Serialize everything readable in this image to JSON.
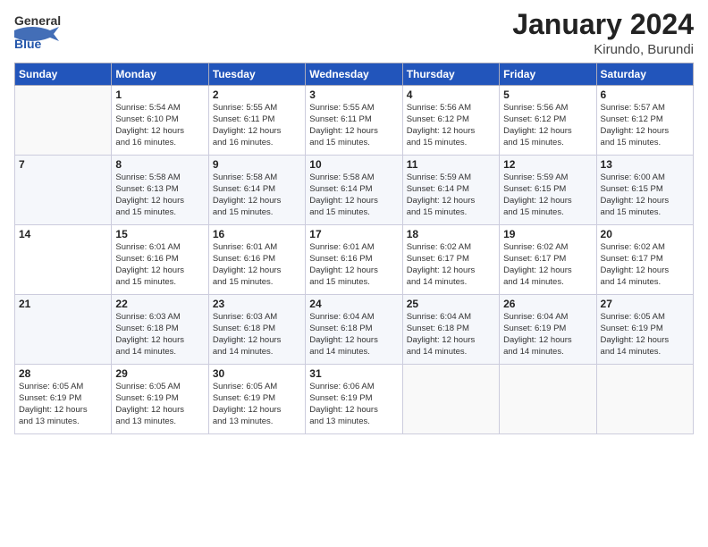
{
  "header": {
    "logo_line1": "General",
    "logo_line2": "Blue",
    "calendar_title": "January 2024",
    "calendar_subtitle": "Kirundo, Burundi"
  },
  "days_of_week": [
    "Sunday",
    "Monday",
    "Tuesday",
    "Wednesday",
    "Thursday",
    "Friday",
    "Saturday"
  ],
  "weeks": [
    [
      {
        "day": "",
        "info": ""
      },
      {
        "day": "1",
        "info": "Sunrise: 5:54 AM\nSunset: 6:10 PM\nDaylight: 12 hours\nand 16 minutes."
      },
      {
        "day": "2",
        "info": "Sunrise: 5:55 AM\nSunset: 6:11 PM\nDaylight: 12 hours\nand 16 minutes."
      },
      {
        "day": "3",
        "info": "Sunrise: 5:55 AM\nSunset: 6:11 PM\nDaylight: 12 hours\nand 15 minutes."
      },
      {
        "day": "4",
        "info": "Sunrise: 5:56 AM\nSunset: 6:12 PM\nDaylight: 12 hours\nand 15 minutes."
      },
      {
        "day": "5",
        "info": "Sunrise: 5:56 AM\nSunset: 6:12 PM\nDaylight: 12 hours\nand 15 minutes."
      },
      {
        "day": "6",
        "info": "Sunrise: 5:57 AM\nSunset: 6:12 PM\nDaylight: 12 hours\nand 15 minutes."
      }
    ],
    [
      {
        "day": "7",
        "info": ""
      },
      {
        "day": "8",
        "info": "Sunrise: 5:58 AM\nSunset: 6:13 PM\nDaylight: 12 hours\nand 15 minutes."
      },
      {
        "day": "9",
        "info": "Sunrise: 5:58 AM\nSunset: 6:14 PM\nDaylight: 12 hours\nand 15 minutes."
      },
      {
        "day": "10",
        "info": "Sunrise: 5:58 AM\nSunset: 6:14 PM\nDaylight: 12 hours\nand 15 minutes."
      },
      {
        "day": "11",
        "info": "Sunrise: 5:59 AM\nSunset: 6:14 PM\nDaylight: 12 hours\nand 15 minutes."
      },
      {
        "day": "12",
        "info": "Sunrise: 5:59 AM\nSunset: 6:15 PM\nDaylight: 12 hours\nand 15 minutes."
      },
      {
        "day": "13",
        "info": "Sunrise: 6:00 AM\nSunset: 6:15 PM\nDaylight: 12 hours\nand 15 minutes."
      }
    ],
    [
      {
        "day": "14",
        "info": ""
      },
      {
        "day": "15",
        "info": "Sunrise: 6:01 AM\nSunset: 6:16 PM\nDaylight: 12 hours\nand 15 minutes."
      },
      {
        "day": "16",
        "info": "Sunrise: 6:01 AM\nSunset: 6:16 PM\nDaylight: 12 hours\nand 15 minutes."
      },
      {
        "day": "17",
        "info": "Sunrise: 6:01 AM\nSunset: 6:16 PM\nDaylight: 12 hours\nand 15 minutes."
      },
      {
        "day": "18",
        "info": "Sunrise: 6:02 AM\nSunset: 6:17 PM\nDaylight: 12 hours\nand 14 minutes."
      },
      {
        "day": "19",
        "info": "Sunrise: 6:02 AM\nSunset: 6:17 PM\nDaylight: 12 hours\nand 14 minutes."
      },
      {
        "day": "20",
        "info": "Sunrise: 6:02 AM\nSunset: 6:17 PM\nDaylight: 12 hours\nand 14 minutes."
      }
    ],
    [
      {
        "day": "21",
        "info": ""
      },
      {
        "day": "22",
        "info": "Sunrise: 6:03 AM\nSunset: 6:18 PM\nDaylight: 12 hours\nand 14 minutes."
      },
      {
        "day": "23",
        "info": "Sunrise: 6:03 AM\nSunset: 6:18 PM\nDaylight: 12 hours\nand 14 minutes."
      },
      {
        "day": "24",
        "info": "Sunrise: 6:04 AM\nSunset: 6:18 PM\nDaylight: 12 hours\nand 14 minutes."
      },
      {
        "day": "25",
        "info": "Sunrise: 6:04 AM\nSunset: 6:18 PM\nDaylight: 12 hours\nand 14 minutes."
      },
      {
        "day": "26",
        "info": "Sunrise: 6:04 AM\nSunset: 6:19 PM\nDaylight: 12 hours\nand 14 minutes."
      },
      {
        "day": "27",
        "info": "Sunrise: 6:05 AM\nSunset: 6:19 PM\nDaylight: 12 hours\nand 14 minutes."
      }
    ],
    [
      {
        "day": "28",
        "info": "Sunrise: 6:05 AM\nSunset: 6:19 PM\nDaylight: 12 hours\nand 13 minutes."
      },
      {
        "day": "29",
        "info": "Sunrise: 6:05 AM\nSunset: 6:19 PM\nDaylight: 12 hours\nand 13 minutes."
      },
      {
        "day": "30",
        "info": "Sunrise: 6:05 AM\nSunset: 6:19 PM\nDaylight: 12 hours\nand 13 minutes."
      },
      {
        "day": "31",
        "info": "Sunrise: 6:06 AM\nSunset: 6:19 PM\nDaylight: 12 hours\nand 13 minutes."
      },
      {
        "day": "",
        "info": ""
      },
      {
        "day": "",
        "info": ""
      },
      {
        "day": "",
        "info": ""
      }
    ]
  ]
}
